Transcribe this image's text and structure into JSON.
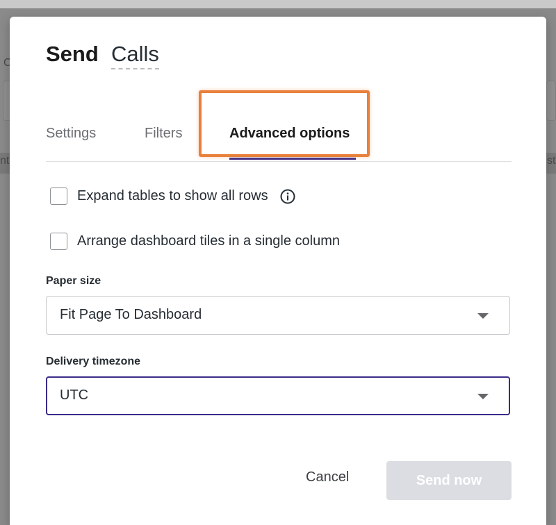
{
  "background": {
    "fragments": [
      "C",
      "nt",
      "st"
    ]
  },
  "dialog": {
    "title": "Send",
    "name": "Calls",
    "tabs": [
      {
        "label": "Settings",
        "active": false
      },
      {
        "label": "Filters",
        "active": false
      },
      {
        "label": "Advanced options",
        "active": true
      }
    ],
    "options": [
      {
        "label": "Expand tables to show all rows",
        "checked": false,
        "has_info": true
      },
      {
        "label": "Arrange dashboard tiles in a single column",
        "checked": false,
        "has_info": false
      }
    ],
    "paper_size": {
      "label": "Paper size",
      "value": "Fit Page To Dashboard"
    },
    "timezone": {
      "label": "Delivery timezone",
      "value": "UTC",
      "focused": true
    },
    "actions": {
      "cancel": "Cancel",
      "send": "Send now",
      "send_disabled": true
    }
  },
  "colors": {
    "accent": "#3a2c8a",
    "highlight": "#e8813b",
    "disabled_button": "#dcdde2"
  },
  "icons": [
    "info-icon",
    "caret-down-icon"
  ]
}
